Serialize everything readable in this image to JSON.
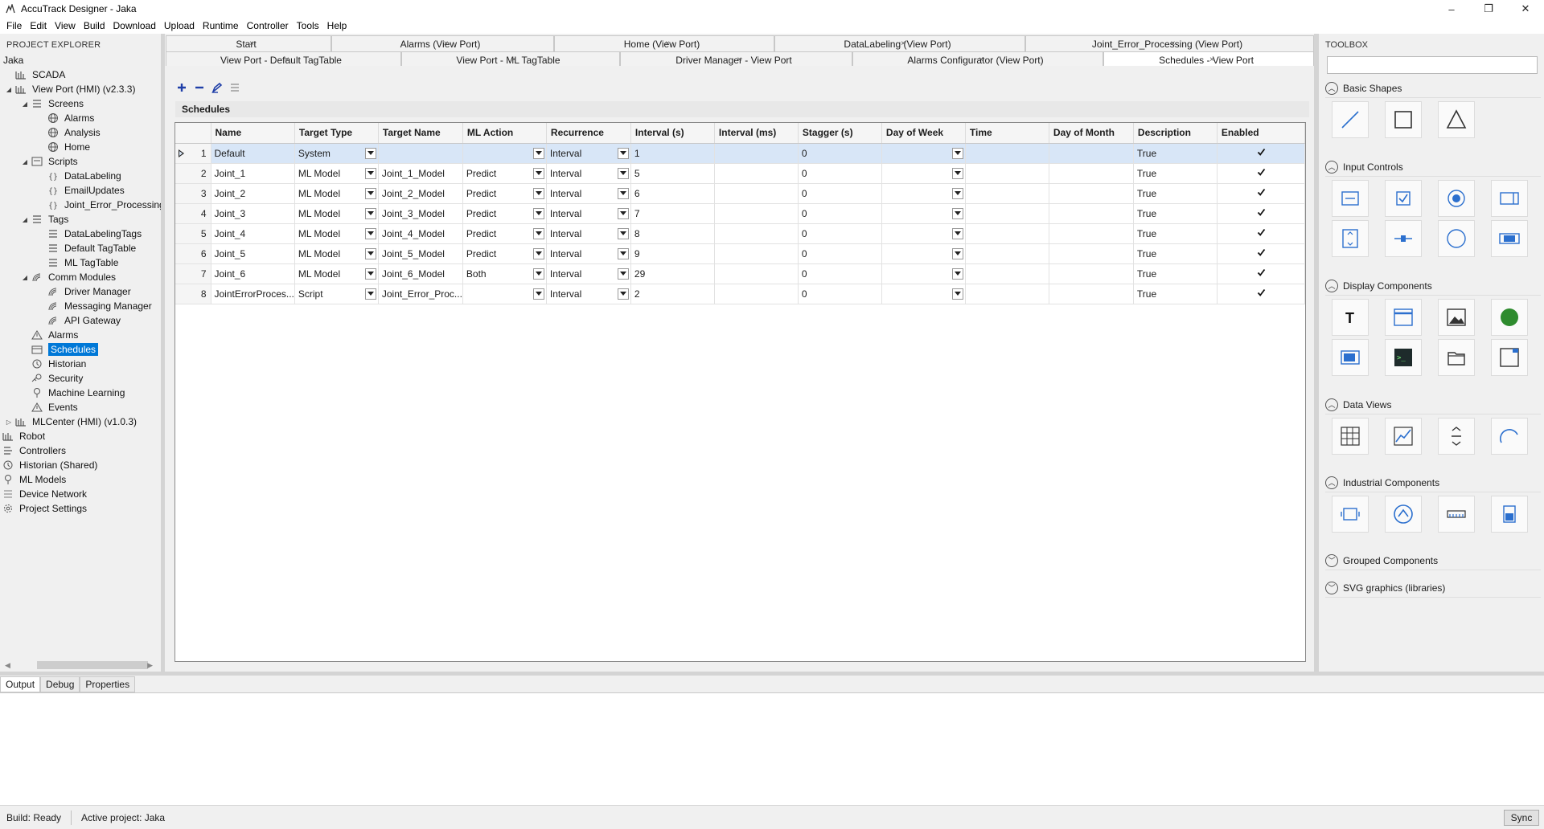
{
  "window": {
    "title": "AccuTrack Designer - Jaka",
    "minimize": "–",
    "maximize": "❐",
    "close": "✕"
  },
  "menu": [
    "File",
    "Edit",
    "View",
    "Build",
    "Download",
    "Upload",
    "Runtime",
    "Controller",
    "Tools",
    "Help"
  ],
  "explorer": {
    "header": "PROJECT EXPLORER",
    "nodes": [
      {
        "label": "Jaka",
        "level": 0,
        "arrow": "",
        "icon": ""
      },
      {
        "label": "SCADA",
        "level": 0,
        "arrow": "",
        "icon": "plc"
      },
      {
        "label": "View Port (HMI) (v2.3.3)",
        "level": 0,
        "arrow": "◢",
        "icon": "plc"
      },
      {
        "label": "Screens",
        "level": 1,
        "arrow": "◢",
        "icon": "list"
      },
      {
        "label": "Alarms",
        "level": 2,
        "arrow": "",
        "icon": "globe"
      },
      {
        "label": "Analysis",
        "level": 2,
        "arrow": "",
        "icon": "globe"
      },
      {
        "label": "Home",
        "level": 2,
        "arrow": "",
        "icon": "globe"
      },
      {
        "label": "Scripts",
        "level": 1,
        "arrow": "◢",
        "icon": "script"
      },
      {
        "label": "DataLabeling",
        "level": 2,
        "arrow": "",
        "icon": "braces"
      },
      {
        "label": "EmailUpdates",
        "level": 2,
        "arrow": "",
        "icon": "braces"
      },
      {
        "label": "Joint_Error_Processing",
        "level": 2,
        "arrow": "",
        "icon": "braces"
      },
      {
        "label": "Tags",
        "level": 1,
        "arrow": "◢",
        "icon": "list"
      },
      {
        "label": "DataLabelingTags",
        "level": 2,
        "arrow": "",
        "icon": "list"
      },
      {
        "label": "Default TagTable",
        "level": 2,
        "arrow": "",
        "icon": "list"
      },
      {
        "label": "ML TagTable",
        "level": 2,
        "arrow": "",
        "icon": "list"
      },
      {
        "label": "Comm Modules",
        "level": 1,
        "arrow": "◢",
        "icon": "signal"
      },
      {
        "label": "Driver Manager",
        "level": 2,
        "arrow": "",
        "icon": "signal"
      },
      {
        "label": "Messaging Manager",
        "level": 2,
        "arrow": "",
        "icon": "signal"
      },
      {
        "label": "API Gateway",
        "level": 2,
        "arrow": "",
        "icon": "signal"
      },
      {
        "label": "Alarms",
        "level": 1,
        "arrow": "",
        "icon": "warning"
      },
      {
        "label": "Schedules",
        "level": 1,
        "arrow": "",
        "icon": "schedule",
        "selected": true
      },
      {
        "label": "Historian",
        "level": 1,
        "arrow": "",
        "icon": "history"
      },
      {
        "label": "Security",
        "level": 1,
        "arrow": "",
        "icon": "key"
      },
      {
        "label": "Machine Learning",
        "level": 1,
        "arrow": "",
        "icon": "bulb"
      },
      {
        "label": "Events",
        "level": 1,
        "arrow": "",
        "icon": "warning"
      },
      {
        "label": "MLCenter (HMI) (v1.0.3)",
        "level": 0,
        "arrow": "▷",
        "icon": "plc"
      },
      {
        "label": "Robot",
        "level": -1,
        "arrow": "",
        "icon": "plc"
      },
      {
        "label": "Controllers",
        "level": -1,
        "arrow": "",
        "icon": "ctrl"
      },
      {
        "label": "Historian (Shared)",
        "level": -1,
        "arrow": "",
        "icon": "history"
      },
      {
        "label": "ML Models",
        "level": -1,
        "arrow": "",
        "icon": "bulb"
      },
      {
        "label": "Device Network",
        "level": -1,
        "arrow": "",
        "icon": "network"
      },
      {
        "label": "Project Settings",
        "level": -1,
        "arrow": "",
        "icon": "gear"
      }
    ]
  },
  "tabs_row1": [
    "Start",
    "Alarms (View Port)",
    "Home (View Port)",
    "DataLabeling (View Port)",
    "Joint_Error_Processing (View Port)"
  ],
  "tabs_row2": [
    "View Port - Default TagTable",
    "View Port - ML TagTable",
    "Driver Manager - View Port",
    "Alarms Configurator (View Port)",
    "Schedules - View Port"
  ],
  "active_tab": "Schedules - View Port",
  "tab_close": "×",
  "section_title": "Schedules",
  "grid": {
    "columns": [
      "Name",
      "Target Type",
      "Target Name",
      "ML Action",
      "Recurrence",
      "Interval (s)",
      "Interval (ms)",
      "Stagger (s)",
      "Day of Week",
      "Time",
      "Day of Month",
      "Description",
      "Enabled"
    ],
    "rows": [
      {
        "num": "1",
        "name": "Default",
        "target_type": "System",
        "target_name": "",
        "ml_action": "",
        "recurrence": "Interval",
        "interval_s": "1",
        "interval_ms": "",
        "stagger": "0",
        "dow": "",
        "time": "",
        "dom": "",
        "description": "True",
        "enabled": true
      },
      {
        "num": "2",
        "name": "Joint_1",
        "target_type": "ML Model",
        "target_name": "Joint_1_Model",
        "ml_action": "Predict",
        "recurrence": "Interval",
        "interval_s": "5",
        "interval_ms": "",
        "stagger": "0",
        "dow": "",
        "time": "",
        "dom": "",
        "description": "True",
        "enabled": true
      },
      {
        "num": "3",
        "name": "Joint_2",
        "target_type": "ML Model",
        "target_name": "Joint_2_Model",
        "ml_action": "Predict",
        "recurrence": "Interval",
        "interval_s": "6",
        "interval_ms": "",
        "stagger": "0",
        "dow": "",
        "time": "",
        "dom": "",
        "description": "True",
        "enabled": true
      },
      {
        "num": "4",
        "name": "Joint_3",
        "target_type": "ML Model",
        "target_name": "Joint_3_Model",
        "ml_action": "Predict",
        "recurrence": "Interval",
        "interval_s": "7",
        "interval_ms": "",
        "stagger": "0",
        "dow": "",
        "time": "",
        "dom": "",
        "description": "True",
        "enabled": true
      },
      {
        "num": "5",
        "name": "Joint_4",
        "target_type": "ML Model",
        "target_name": "Joint_4_Model",
        "ml_action": "Predict",
        "recurrence": "Interval",
        "interval_s": "8",
        "interval_ms": "",
        "stagger": "0",
        "dow": "",
        "time": "",
        "dom": "",
        "description": "True",
        "enabled": true
      },
      {
        "num": "6",
        "name": "Joint_5",
        "target_type": "ML Model",
        "target_name": "Joint_5_Model",
        "ml_action": "Predict",
        "recurrence": "Interval",
        "interval_s": "9",
        "interval_ms": "",
        "stagger": "0",
        "dow": "",
        "time": "",
        "dom": "",
        "description": "True",
        "enabled": true
      },
      {
        "num": "7",
        "name": "Joint_6",
        "target_type": "ML Model",
        "target_name": "Joint_6_Model",
        "ml_action": "Both",
        "recurrence": "Interval",
        "interval_s": "29",
        "interval_ms": "",
        "stagger": "0",
        "dow": "",
        "time": "",
        "dom": "",
        "description": "True",
        "enabled": true
      },
      {
        "num": "8",
        "name": "JointErrorProces...",
        "target_type": "Script",
        "target_name": "Joint_Error_Proc...",
        "ml_action": "",
        "recurrence": "Interval",
        "interval_s": "2",
        "interval_ms": "",
        "stagger": "0",
        "dow": "",
        "time": "",
        "dom": "",
        "description": "True",
        "enabled": true
      }
    ]
  },
  "toolbox": {
    "header": "TOOLBOX",
    "search_placeholder": "",
    "categories": [
      {
        "label": "Basic Shapes",
        "expanded": true,
        "items": [
          "line-tool-icon",
          "rectangle-tool-icon",
          "triangle-tool-icon"
        ]
      },
      {
        "label": "Input Controls",
        "expanded": true,
        "items": [
          "textbox-icon",
          "checkbox-icon",
          "radio-button-icon",
          "combobox-icon",
          "spinner-icon",
          "slider-icon",
          "ellipse-button-icon",
          "toggle-button-icon"
        ]
      },
      {
        "label": "Display Components",
        "expanded": true,
        "items": [
          "text-tool-icon",
          "window-tool-icon",
          "image-tool-icon",
          "indicator-light-icon",
          "display-panel-icon",
          "terminal-icon",
          "folder-icon",
          "frame-icon"
        ]
      },
      {
        "label": "Data Views",
        "expanded": true,
        "items": [
          "table-view-icon",
          "trend-chart-icon",
          "converter-icon",
          "gauge-icon"
        ]
      },
      {
        "label": "Industrial Components",
        "expanded": true,
        "items": [
          "pump-icon",
          "motor-icon",
          "conveyor-icon",
          "tank-icon"
        ]
      },
      {
        "label": "Grouped Components",
        "expanded": false,
        "items": []
      },
      {
        "label": "SVG graphics (libraries)",
        "expanded": false,
        "items": []
      }
    ]
  },
  "bottom_tabs": [
    "Output",
    "Debug",
    "Properties"
  ],
  "status": {
    "build": "Build: Ready",
    "project": "Active project: Jaka",
    "sync": "Sync"
  },
  "colors": {
    "accent": "#0078d7",
    "selected_row": "#d8e6f7",
    "toolbar_blue": "#1f3fa8",
    "green": "#2e8b2e"
  }
}
